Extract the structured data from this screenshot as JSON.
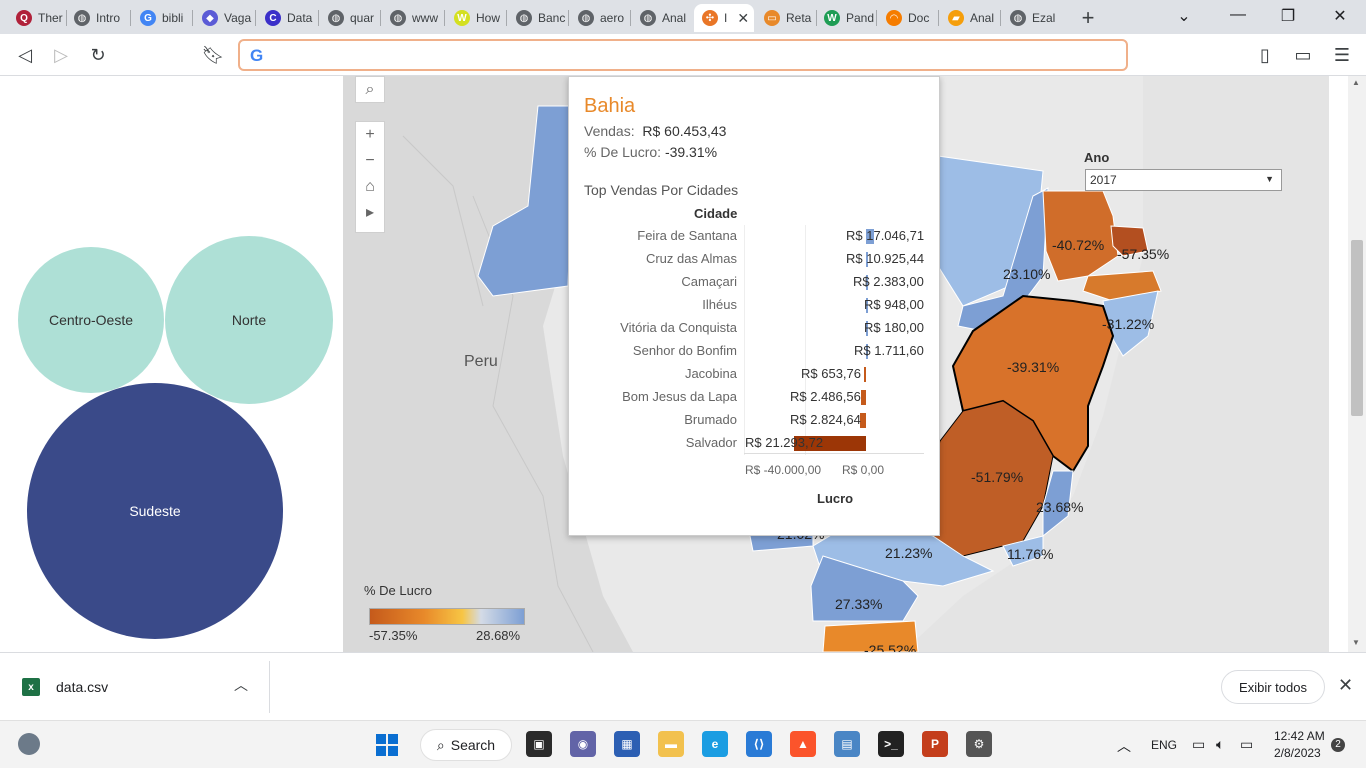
{
  "browser": {
    "tabs": [
      {
        "label": "Ther",
        "color": "#b0213a",
        "glyph": "Q"
      },
      {
        "label": "Intro",
        "color": "#5f6368",
        "glyph": "◍"
      },
      {
        "label": "bibli",
        "color": "#4285f4",
        "glyph": "G"
      },
      {
        "label": "Vaga",
        "color": "#5b5bd6",
        "glyph": "◆"
      },
      {
        "label": "Data",
        "color": "#3b2fc9",
        "glyph": "C"
      },
      {
        "label": "quar",
        "color": "#5f6368",
        "glyph": "◍"
      },
      {
        "label": "www",
        "color": "#5f6368",
        "glyph": "◍"
      },
      {
        "label": "How",
        "color": "#d4e021",
        "glyph": "W"
      },
      {
        "label": "Banc",
        "color": "#5f6368",
        "glyph": "◍"
      },
      {
        "label": "aero",
        "color": "#5f6368",
        "glyph": "◍"
      },
      {
        "label": "Anal",
        "color": "#5f6368",
        "glyph": "◍"
      },
      {
        "label": "I",
        "color": "#e97627",
        "glyph": "✣"
      },
      {
        "label": "Reta",
        "color": "#e8892a",
        "glyph": "▭"
      },
      {
        "label": "Pand",
        "color": "#1f9d55",
        "glyph": "W"
      },
      {
        "label": "Doc",
        "color": "#f57c00",
        "glyph": "◠"
      },
      {
        "label": "Anal",
        "color": "#f59e0b",
        "glyph": "▰"
      },
      {
        "label": "Ezal",
        "color": "#5f6368",
        "glyph": "◍"
      }
    ],
    "omnibox_value": ""
  },
  "bubbles": {
    "centro_oeste": "Centro-Oeste",
    "norte": "Norte",
    "sudeste": "Sudeste"
  },
  "map": {
    "peru_label": "Peru",
    "legend": {
      "title": "% De Lucro",
      "min": "-57.35%",
      "max": "28.68%"
    },
    "filter": {
      "label": "Ano",
      "value": "2017"
    },
    "state_values": [
      {
        "name": "ceara",
        "pct": "-40.72%"
      },
      {
        "name": "rio-grande-do-norte",
        "pct": "-57.35%"
      },
      {
        "name": "piaui",
        "pct": "23.10%"
      },
      {
        "name": "sergipe",
        "pct": "-31.22%"
      },
      {
        "name": "bahia",
        "pct": "-39.31%"
      },
      {
        "name": "minas-gerais",
        "pct": "-51.79%"
      },
      {
        "name": "espirito-santo",
        "pct": "23.68%"
      },
      {
        "name": "rio-de-janeiro",
        "pct": "11.76%"
      },
      {
        "name": "sao-paulo",
        "pct": "21.23%"
      },
      {
        "name": "parana",
        "pct": "27.33%"
      },
      {
        "name": "santa-catarina",
        "pct": "-25.52%"
      },
      {
        "name": "mato-grosso-do-sul",
        "pct": "21.02%"
      }
    ]
  },
  "tooltip": {
    "state": "Bahia",
    "vendas_label": "Vendas:",
    "vendas_value": "R$ 60.453,43",
    "lucro_label": "% De Lucro:",
    "lucro_value": "-39.31%",
    "subtitle": "Top Vendas Por Cidades",
    "column_header": "Cidade",
    "axis_min": "R$ -40.000,00",
    "axis_zero": "R$ 0,00",
    "axis_title": "Lucro"
  },
  "chart_data": {
    "type": "bar",
    "title": "Top Vendas Por Cidades",
    "xlabel": "Lucro",
    "ylabel": "Cidade",
    "categories": [
      "Feira de Santana",
      "Cruz das Almas",
      "Camaçari",
      "Ilhéus",
      "Vitória da Conquista",
      "Senhor do Bonfim",
      "Jacobina",
      "Bom Jesus da Lapa",
      "Brumado",
      "Salvador"
    ],
    "values": [
      2300,
      700,
      200,
      100,
      50,
      100,
      -300,
      -1600,
      -1700,
      -21000
    ],
    "value_labels": [
      "R$ 17.046,71",
      "R$ 10.925,44",
      "R$ 2.383,00",
      "R$ 948,00",
      "R$ 180,00",
      "R$ 1.711,60",
      "R$ 653,76",
      "R$ 2.486,56",
      "R$ 2.824,64",
      "R$ 21.293,72"
    ],
    "xlim": [
      -40000,
      10000
    ],
    "colors": {
      "positive": "#7d9fd4",
      "negative_small": "#c55a1b",
      "negative_large": "#9c3606"
    }
  },
  "downloads": {
    "file": "data.csv",
    "show_all": "Exibir todos"
  },
  "taskbar": {
    "search": "Search",
    "lang": "ENG",
    "time": "12:42 AM",
    "date": "2/8/2023",
    "badge": "2"
  }
}
